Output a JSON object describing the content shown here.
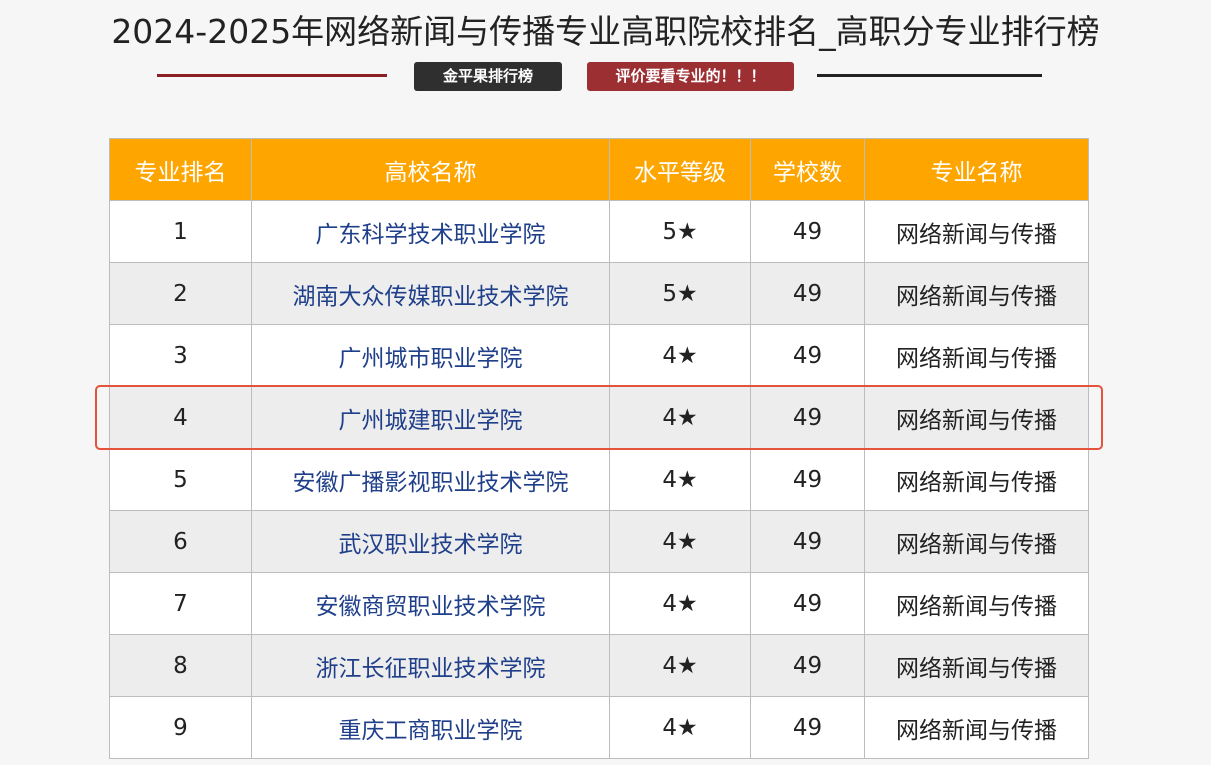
{
  "page": {
    "title": "2024-2025年网络新闻与传播专业高职院校排名_高职分专业排行榜",
    "badge_left": "金平果排行榜",
    "badge_right": "评价要看专业的！！！"
  },
  "table": {
    "headers": [
      "专业排名",
      "高校名称",
      "水平等级",
      "学校数",
      "专业名称"
    ],
    "rows": [
      {
        "rank": "1",
        "school": "广东科学技术职业学院",
        "level": "5★",
        "count": "49",
        "major": "网络新闻与传播"
      },
      {
        "rank": "2",
        "school": "湖南大众传媒职业技术学院",
        "level": "5★",
        "count": "49",
        "major": "网络新闻与传播"
      },
      {
        "rank": "3",
        "school": "广州城市职业学院",
        "level": "4★",
        "count": "49",
        "major": "网络新闻与传播"
      },
      {
        "rank": "4",
        "school": "广州城建职业学院",
        "level": "4★",
        "count": "49",
        "major": "网络新闻与传播"
      },
      {
        "rank": "5",
        "school": "安徽广播影视职业技术学院",
        "level": "4★",
        "count": "49",
        "major": "网络新闻与传播"
      },
      {
        "rank": "6",
        "school": "武汉职业技术学院",
        "level": "4★",
        "count": "49",
        "major": "网络新闻与传播"
      },
      {
        "rank": "7",
        "school": "安徽商贸职业技术学院",
        "level": "4★",
        "count": "49",
        "major": "网络新闻与传播"
      },
      {
        "rank": "8",
        "school": "浙江长征职业技术学院",
        "level": "4★",
        "count": "49",
        "major": "网络新闻与传播"
      },
      {
        "rank": "9",
        "school": "重庆工商职业学院",
        "level": "4★",
        "count": "49",
        "major": "网络新闻与传播"
      }
    ]
  },
  "colors": {
    "header_bg": "#ffa500",
    "link": "#1f3f8a",
    "highlight": "#e5533c",
    "badge_dark": "#2f2f2f",
    "badge_red": "#9c2f32"
  }
}
